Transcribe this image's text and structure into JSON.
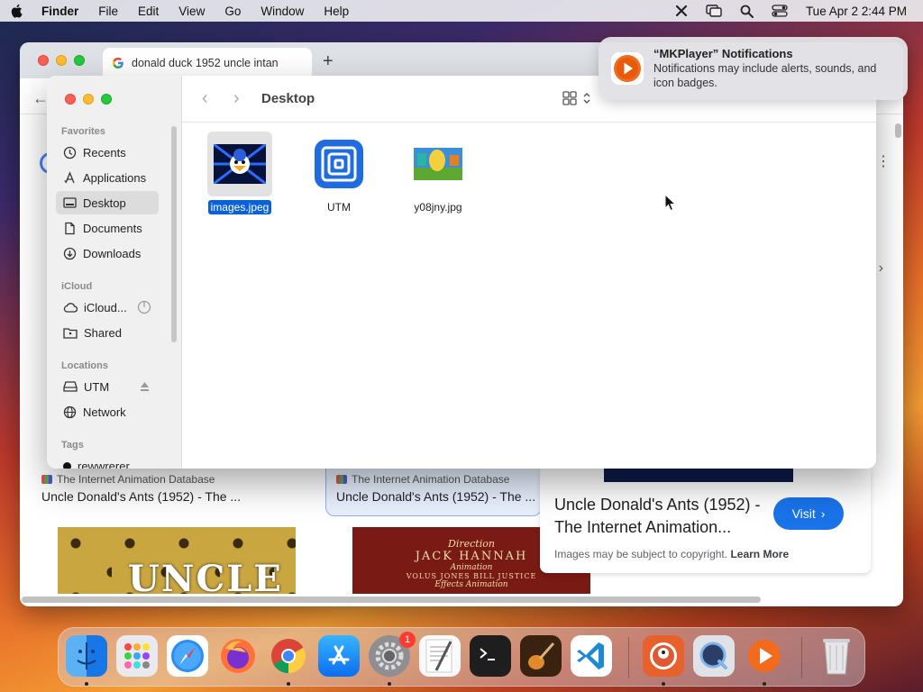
{
  "menubar": {
    "app_name": "Finder",
    "menus": [
      "File",
      "Edit",
      "View",
      "Go",
      "Window",
      "Help"
    ],
    "clock": "Tue Apr 2  2:44 PM"
  },
  "browser": {
    "tab_title": "donald duck 1952 uncle intan",
    "new_tab_symbol": "+",
    "results": [
      {
        "source": "The Internet Animation Database",
        "title": "Uncle Donald's Ants (1952) - The ..."
      },
      {
        "source": "The Internet Animation Database",
        "title": "Uncle Donald's Ants (1952) - The ..."
      }
    ],
    "thumb_ants_text": "UNCLE",
    "thumb_credits": {
      "line1": "Direction",
      "line2": "JACK  HANNAH",
      "line3": "Animation",
      "line4": "VOLUS   JONES        BILL   JUSTICE",
      "line5": "Effects Animation"
    },
    "panel": {
      "title": "Uncle Donald's Ants (1952) - The Internet Animation...",
      "visit_label": "Visit",
      "copyright_text": "Images may be subject to copyright.",
      "learn_more": "Learn More"
    }
  },
  "finder": {
    "title": "Desktop",
    "sidebar": {
      "favorites_header": "Favorites",
      "favorites": [
        {
          "label": "Recents",
          "icon": "clock-icon"
        },
        {
          "label": "Applications",
          "icon": "applications-icon"
        },
        {
          "label": "Desktop",
          "icon": "desktop-icon",
          "selected": true
        },
        {
          "label": "Documents",
          "icon": "document-icon"
        },
        {
          "label": "Downloads",
          "icon": "download-icon"
        }
      ],
      "icloud_header": "iCloud",
      "icloud": [
        {
          "label": "iCloud...",
          "icon": "cloud-icon"
        },
        {
          "label": "Shared",
          "icon": "shared-folder-icon"
        }
      ],
      "locations_header": "Locations",
      "locations": [
        {
          "label": "UTM",
          "icon": "drive-icon"
        },
        {
          "label": "Network",
          "icon": "globe-icon"
        }
      ],
      "tags_header": "Tags",
      "tags": [
        {
          "label": "rewwrerer",
          "color": "#111111"
        }
      ]
    },
    "files": [
      {
        "name": "images.jpeg",
        "selected": true
      },
      {
        "name": "UTM",
        "selected": false
      },
      {
        "name": "y08jny.jpg",
        "selected": false
      }
    ]
  },
  "notification": {
    "title": "“MKPlayer” Notifications",
    "body": "Notifications may include alerts, sounds, and icon badges."
  },
  "dock": {
    "apps": [
      "Finder",
      "Launchpad",
      "Safari",
      "Firefox",
      "Chrome",
      "App Store",
      "System Settings",
      "TextEdit",
      "Terminal",
      "GarageBand",
      "VS Code",
      "DuckDuckGo",
      "QuickTime",
      "MKPlayer",
      "Trash"
    ],
    "system_settings_badge": "1"
  }
}
